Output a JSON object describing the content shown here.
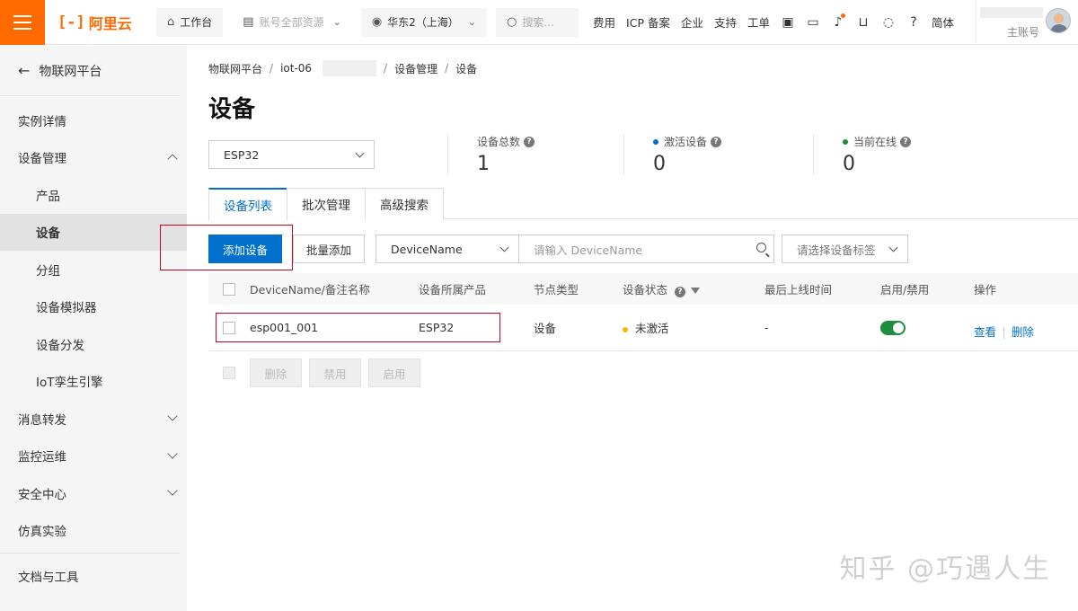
{
  "header": {
    "logo_text": "阿里云",
    "workbench": "工作台",
    "resources": "账号全部资源",
    "region": "华东2（上海）",
    "search_placeholder": "搜索...",
    "links": [
      "费用",
      "ICP 备案",
      "企业",
      "支持",
      "工单"
    ],
    "lang": "简体",
    "account_sub": "主账号"
  },
  "sidebar": {
    "back_label": "物联网平台",
    "items": [
      {
        "label": "实例详情"
      },
      {
        "label": "设备管理"
      },
      {
        "label": "产品"
      },
      {
        "label": "设备"
      },
      {
        "label": "分组"
      },
      {
        "label": "设备模拟器"
      },
      {
        "label": "设备分发"
      },
      {
        "label": "IoT孪生引擎"
      },
      {
        "label": "消息转发"
      },
      {
        "label": "监控运维"
      },
      {
        "label": "安全中心"
      },
      {
        "label": "仿真实验"
      },
      {
        "label": "文档与工具"
      }
    ]
  },
  "breadcrumb": [
    "物联网平台",
    "iot-06",
    "设备管理",
    "设备"
  ],
  "page": {
    "title": "设备",
    "product_selected": "ESP32",
    "stats": [
      {
        "label": "设备总数",
        "value": "1",
        "dot_color": ""
      },
      {
        "label": "激活设备",
        "value": "0",
        "dot_color": "#0070cc"
      },
      {
        "label": "当前在线",
        "value": "0",
        "dot_color": "#1e8e3e"
      }
    ],
    "tabs": [
      "设备列表",
      "批次管理",
      "高级搜索"
    ],
    "toolbar": {
      "add_device": "添加设备",
      "batch_add": "批量添加",
      "filter_field": "DeviceName",
      "search_placeholder": "请输入 DeviceName",
      "tag_placeholder": "请选择设备标签"
    },
    "table": {
      "headers": [
        "DeviceName/备注名称",
        "设备所属产品",
        "节点类型",
        "设备状态",
        "最后上线时间",
        "启用/禁用",
        "操作"
      ],
      "rows": [
        {
          "device_name": "esp001_001",
          "product": "ESP32",
          "node_type": "设备",
          "status": "未激活",
          "last_online": "-",
          "enabled": true,
          "action_view": "查看",
          "action_delete": "删除"
        }
      ]
    },
    "batch_actions": [
      "删除",
      "禁用",
      "启用"
    ]
  },
  "watermark": "知乎 @巧遇人生",
  "colors": {
    "brand": "#ff6a00",
    "primary": "#0070cc",
    "highlight": "#d0021b",
    "enabled": "#1e8e3e"
  }
}
